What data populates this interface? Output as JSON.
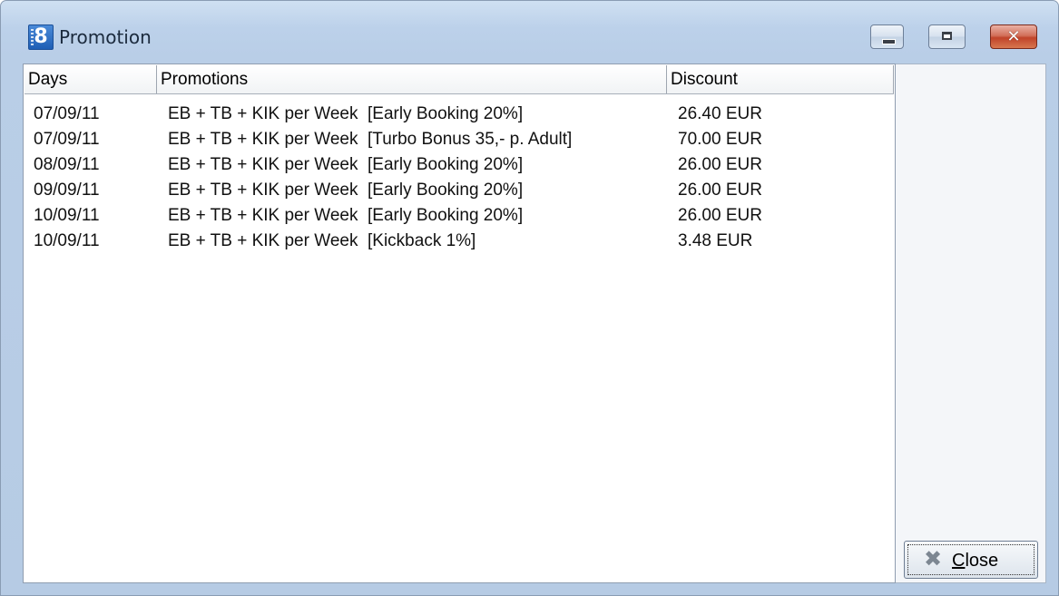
{
  "window": {
    "title": "Promotion",
    "app_icon": "8",
    "controls": {
      "minimize": "minimize-icon",
      "maximize": "maximize-icon",
      "close": "close-icon"
    }
  },
  "table": {
    "columns": {
      "days": "Days",
      "promotions": "Promotions",
      "discount": "Discount"
    },
    "rows": [
      {
        "day": "07/09/11",
        "promotion": "EB + TB + KIK per Week  [Early Booking 20%]",
        "discount": "26.40 EUR"
      },
      {
        "day": "07/09/11",
        "promotion": "EB + TB + KIK per Week  [Turbo Bonus 35,- p. Adult]",
        "discount": "70.00 EUR"
      },
      {
        "day": "08/09/11",
        "promotion": "EB + TB + KIK per Week  [Early Booking 20%]",
        "discount": "26.00 EUR"
      },
      {
        "day": "09/09/11",
        "promotion": "EB + TB + KIK per Week  [Early Booking 20%]",
        "discount": "26.00 EUR"
      },
      {
        "day": "10/09/11",
        "promotion": "EB + TB + KIK per Week  [Early Booking 20%]",
        "discount": "26.00 EUR"
      },
      {
        "day": "10/09/11",
        "promotion": "EB + TB + KIK per Week  [Kickback 1%]",
        "discount": "3.48 EUR"
      }
    ]
  },
  "buttons": {
    "close_first": "C",
    "close_rest": "lose"
  },
  "colors": {
    "titlebar": "#bcd1ea",
    "close_control": "#c0432a"
  }
}
